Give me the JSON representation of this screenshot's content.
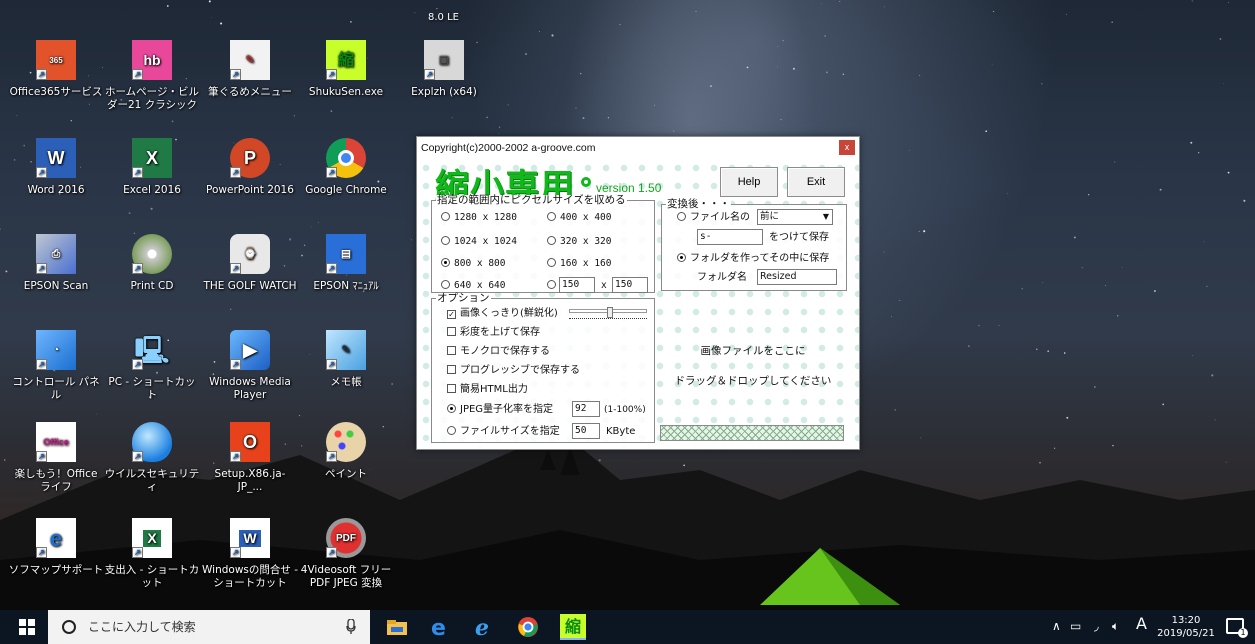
{
  "desktop": {
    "top_partial_label": "8.0 LE",
    "icons": [
      {
        "label": "Office365サービス",
        "icon": "office365-icon"
      },
      {
        "label": "ホームページ・ビルダー21 クラシック",
        "icon": "homepage-builder-icon"
      },
      {
        "label": "筆ぐるめメニュー",
        "icon": "fudegurume-icon"
      },
      {
        "label": "ShukuSen.exe",
        "icon": "shukusen-icon"
      },
      {
        "label": "Explzh (x64)",
        "icon": "explzh-icon"
      },
      {
        "label": "Word 2016",
        "icon": "word-icon"
      },
      {
        "label": "Excel 2016",
        "icon": "excel-icon"
      },
      {
        "label": "PowerPoint 2016",
        "icon": "powerpoint-icon"
      },
      {
        "label": "Google Chrome",
        "icon": "chrome-icon"
      },
      {
        "label": "EPSON Scan",
        "icon": "epson-scan-icon"
      },
      {
        "label": "Print CD",
        "icon": "print-cd-icon"
      },
      {
        "label": "THE GOLF WATCH",
        "icon": "golf-watch-icon"
      },
      {
        "label": "EPSON ﾏﾆｭｱﾙ",
        "icon": "epson-manual-icon"
      },
      {
        "label": "コントロール パネル",
        "icon": "control-panel-icon"
      },
      {
        "label": "PC - ショートカット",
        "icon": "pc-icon"
      },
      {
        "label": "Windows Media Player",
        "icon": "media-player-icon"
      },
      {
        "label": "メモ帳",
        "icon": "notepad-icon"
      },
      {
        "label": "楽しもう！Office ライフ",
        "icon": "office-life-icon"
      },
      {
        "label": "ウイルスセキュリティ",
        "icon": "virus-security-icon"
      },
      {
        "label": "Setup.X86.ja-JP_...",
        "icon": "office-setup-icon"
      },
      {
        "label": "ペイント",
        "icon": "paint-icon"
      },
      {
        "label": "ソフマップサポート",
        "icon": "sofmap-icon"
      },
      {
        "label": "支出入 - ショートカット",
        "icon": "excel-file-icon"
      },
      {
        "label": "Windowsの問合せ - ショートカット",
        "icon": "word-file-icon"
      },
      {
        "label": "4Videosoft フリーPDF JPEG 変換",
        "icon": "pdf-jpeg-icon"
      }
    ]
  },
  "app": {
    "title": "Copyright(c)2000-2002 a-groove.com",
    "close_label": "x",
    "logo": "縮小専用",
    "version": "version 1.50",
    "help_label": "Help",
    "exit_label": "Exit",
    "size_group": {
      "legend": "指定の範囲内にピクセルサイズを収める",
      "options": [
        "1280 x 1280",
        "400 x 400",
        "1024 x 1024",
        "320 x 320",
        "800 x 800",
        "160 x 160",
        "640 x 640"
      ],
      "selected": "800 x 800",
      "custom_w": "150",
      "custom_x": "x",
      "custom_h": "150"
    },
    "convert_group": {
      "legend": "変換後・・・",
      "prefix_label": "ファイル名の",
      "prefix_select": "前に",
      "prefix_text": "s-",
      "prefix_suffix": "をつけて保存",
      "folder_label": "フォルダを作ってその中に保存",
      "folder_name_label": "フォルダ名",
      "folder_name": "Resized",
      "selected": "フォルダを作ってその中に保存"
    },
    "options_group": {
      "legend": "オプション",
      "sharpen": "画像くっきり(鮮鋭化)",
      "sharpen_checked": true,
      "saturation": "彩度を上げて保存",
      "mono": "モノクロで保存する",
      "progressive": "プログレッシブで保存する",
      "html": "簡易HTML出力",
      "jpeg_quality_label": "JPEG量子化率を指定",
      "jpeg_quality": "92",
      "jpeg_quality_range": "(1-100%)",
      "filesize_label": "ファイルサイズを指定",
      "filesize": "50",
      "filesize_unit": "KByte"
    },
    "drop_line1": "画像ファイルをここに",
    "drop_line2": "ドラッグ＆ドロップしてください"
  },
  "taskbar": {
    "search_placeholder": "ここに入力して検索",
    "ime": "A",
    "time": "13:20",
    "date": "2019/05/21",
    "notification_count": "1"
  }
}
